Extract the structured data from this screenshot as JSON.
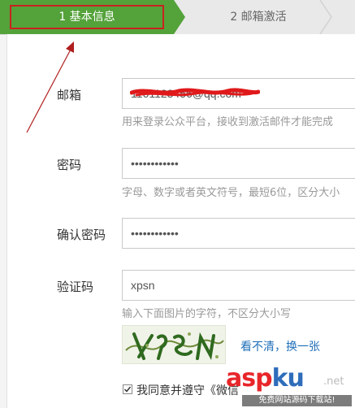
{
  "steps": [
    {
      "label": "1 基本信息"
    },
    {
      "label": "2 邮箱激活"
    }
  ],
  "form": {
    "email": {
      "label": "邮箱",
      "value": "1161123456@qq.com",
      "hint": "用来登录公众平台，接收到激活邮件才能完成"
    },
    "password": {
      "label": "密码",
      "value": "••••••••••••",
      "hint": "字母、数字或者英文符号，最短6位，区分大小"
    },
    "confirm": {
      "label": "确认密码",
      "value": "••••••••••••"
    },
    "captcha": {
      "label": "验证码",
      "value": "xpsn",
      "hint": "输入下面图片的字符，不区分大小写",
      "refresh_link": "看不清，换一张"
    },
    "agree": {
      "text": "我同意并遵守《微信"
    }
  },
  "watermark": {
    "asp": "asp",
    "ku": "ku",
    "net": ".net",
    "sub": "免费网站源码下载站!"
  },
  "colors": {
    "step_active": "#54a23a",
    "step_inactive": "#e9e9e9",
    "highlight_border": "#c8231f",
    "link": "#1f6fb8",
    "watermark_red": "#e8262a",
    "watermark_blue": "#2f6dbb"
  }
}
